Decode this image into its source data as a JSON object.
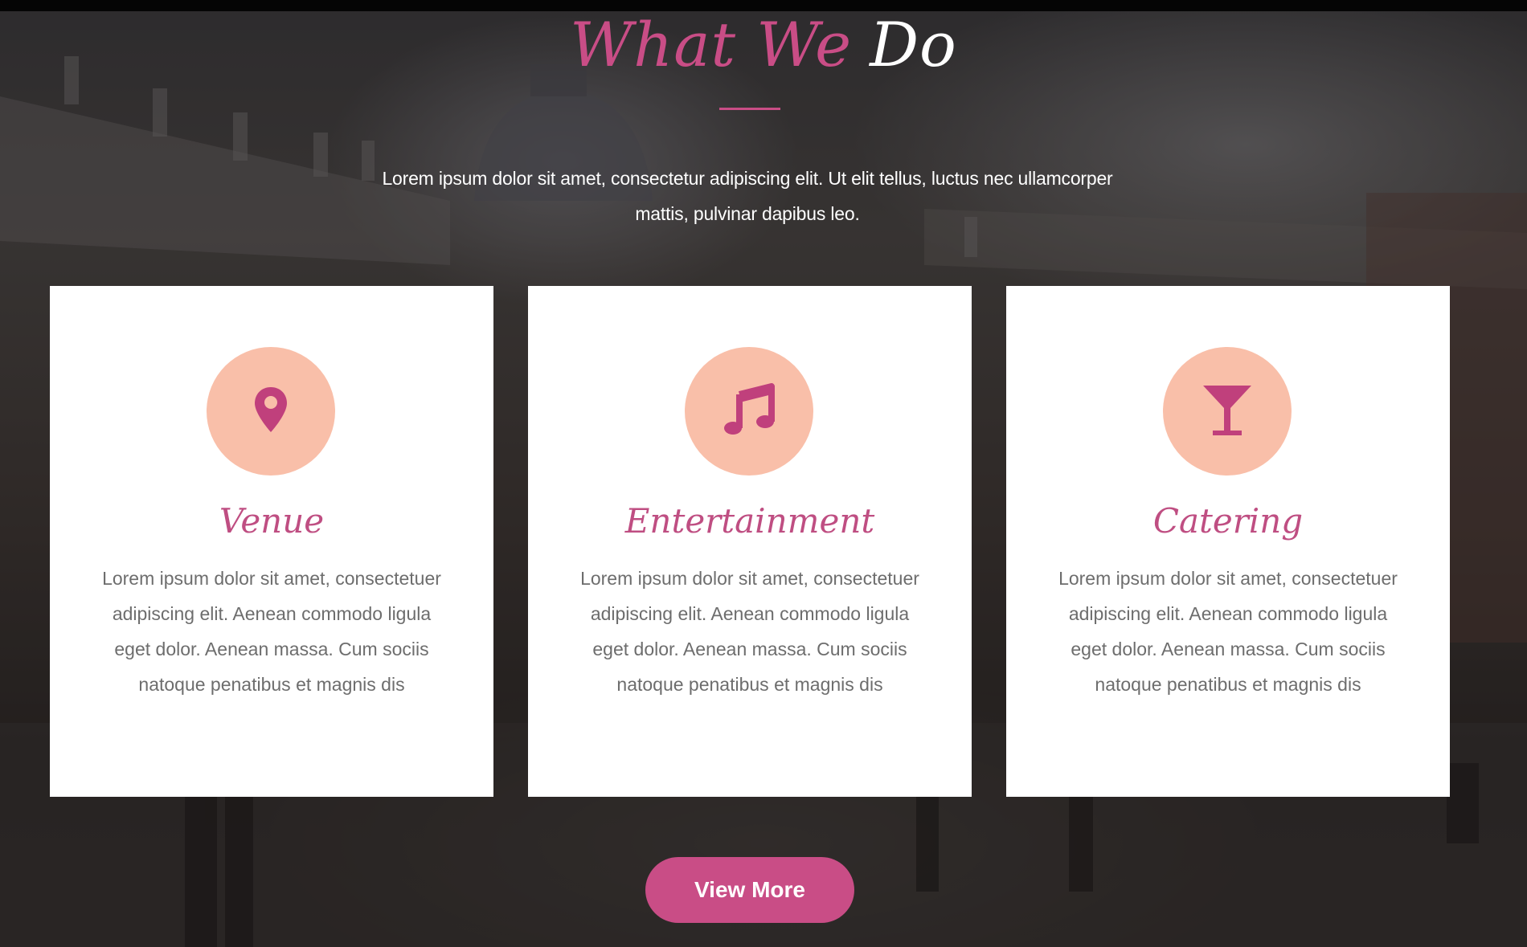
{
  "section": {
    "title_accent": "What We",
    "title_main": "Do",
    "intro": "Lorem ipsum dolor sit amet, consectetur adipiscing elit. Ut elit tellus, luctus nec ullamcorper mattis, pulvinar dapibus leo."
  },
  "cards": [
    {
      "icon": "map-pin-icon",
      "title": "Venue",
      "text": "Lorem ipsum dolor sit amet, consectetuer adipiscing elit. Aenean commodo ligula eget dolor. Aenean massa. Cum sociis natoque penatibus et magnis dis"
    },
    {
      "icon": "music-note-icon",
      "title": "Entertainment",
      "text": "Lorem ipsum dolor sit amet, consectetuer adipiscing elit. Aenean commodo ligula eget dolor. Aenean massa. Cum sociis natoque penatibus et magnis dis"
    },
    {
      "icon": "cocktail-glass-icon",
      "title": "Catering",
      "text": "Lorem ipsum dolor sit amet, consectetuer adipiscing elit. Aenean commodo ligula eget dolor. Aenean massa. Cum sociis natoque penatibus et magnis dis"
    }
  ],
  "cta": {
    "label": "View More"
  },
  "colors": {
    "accent": "#c94d86",
    "icon_circle": "#f9bfa9",
    "card_title": "#bf4e82",
    "body_text": "#6d6d6d"
  }
}
